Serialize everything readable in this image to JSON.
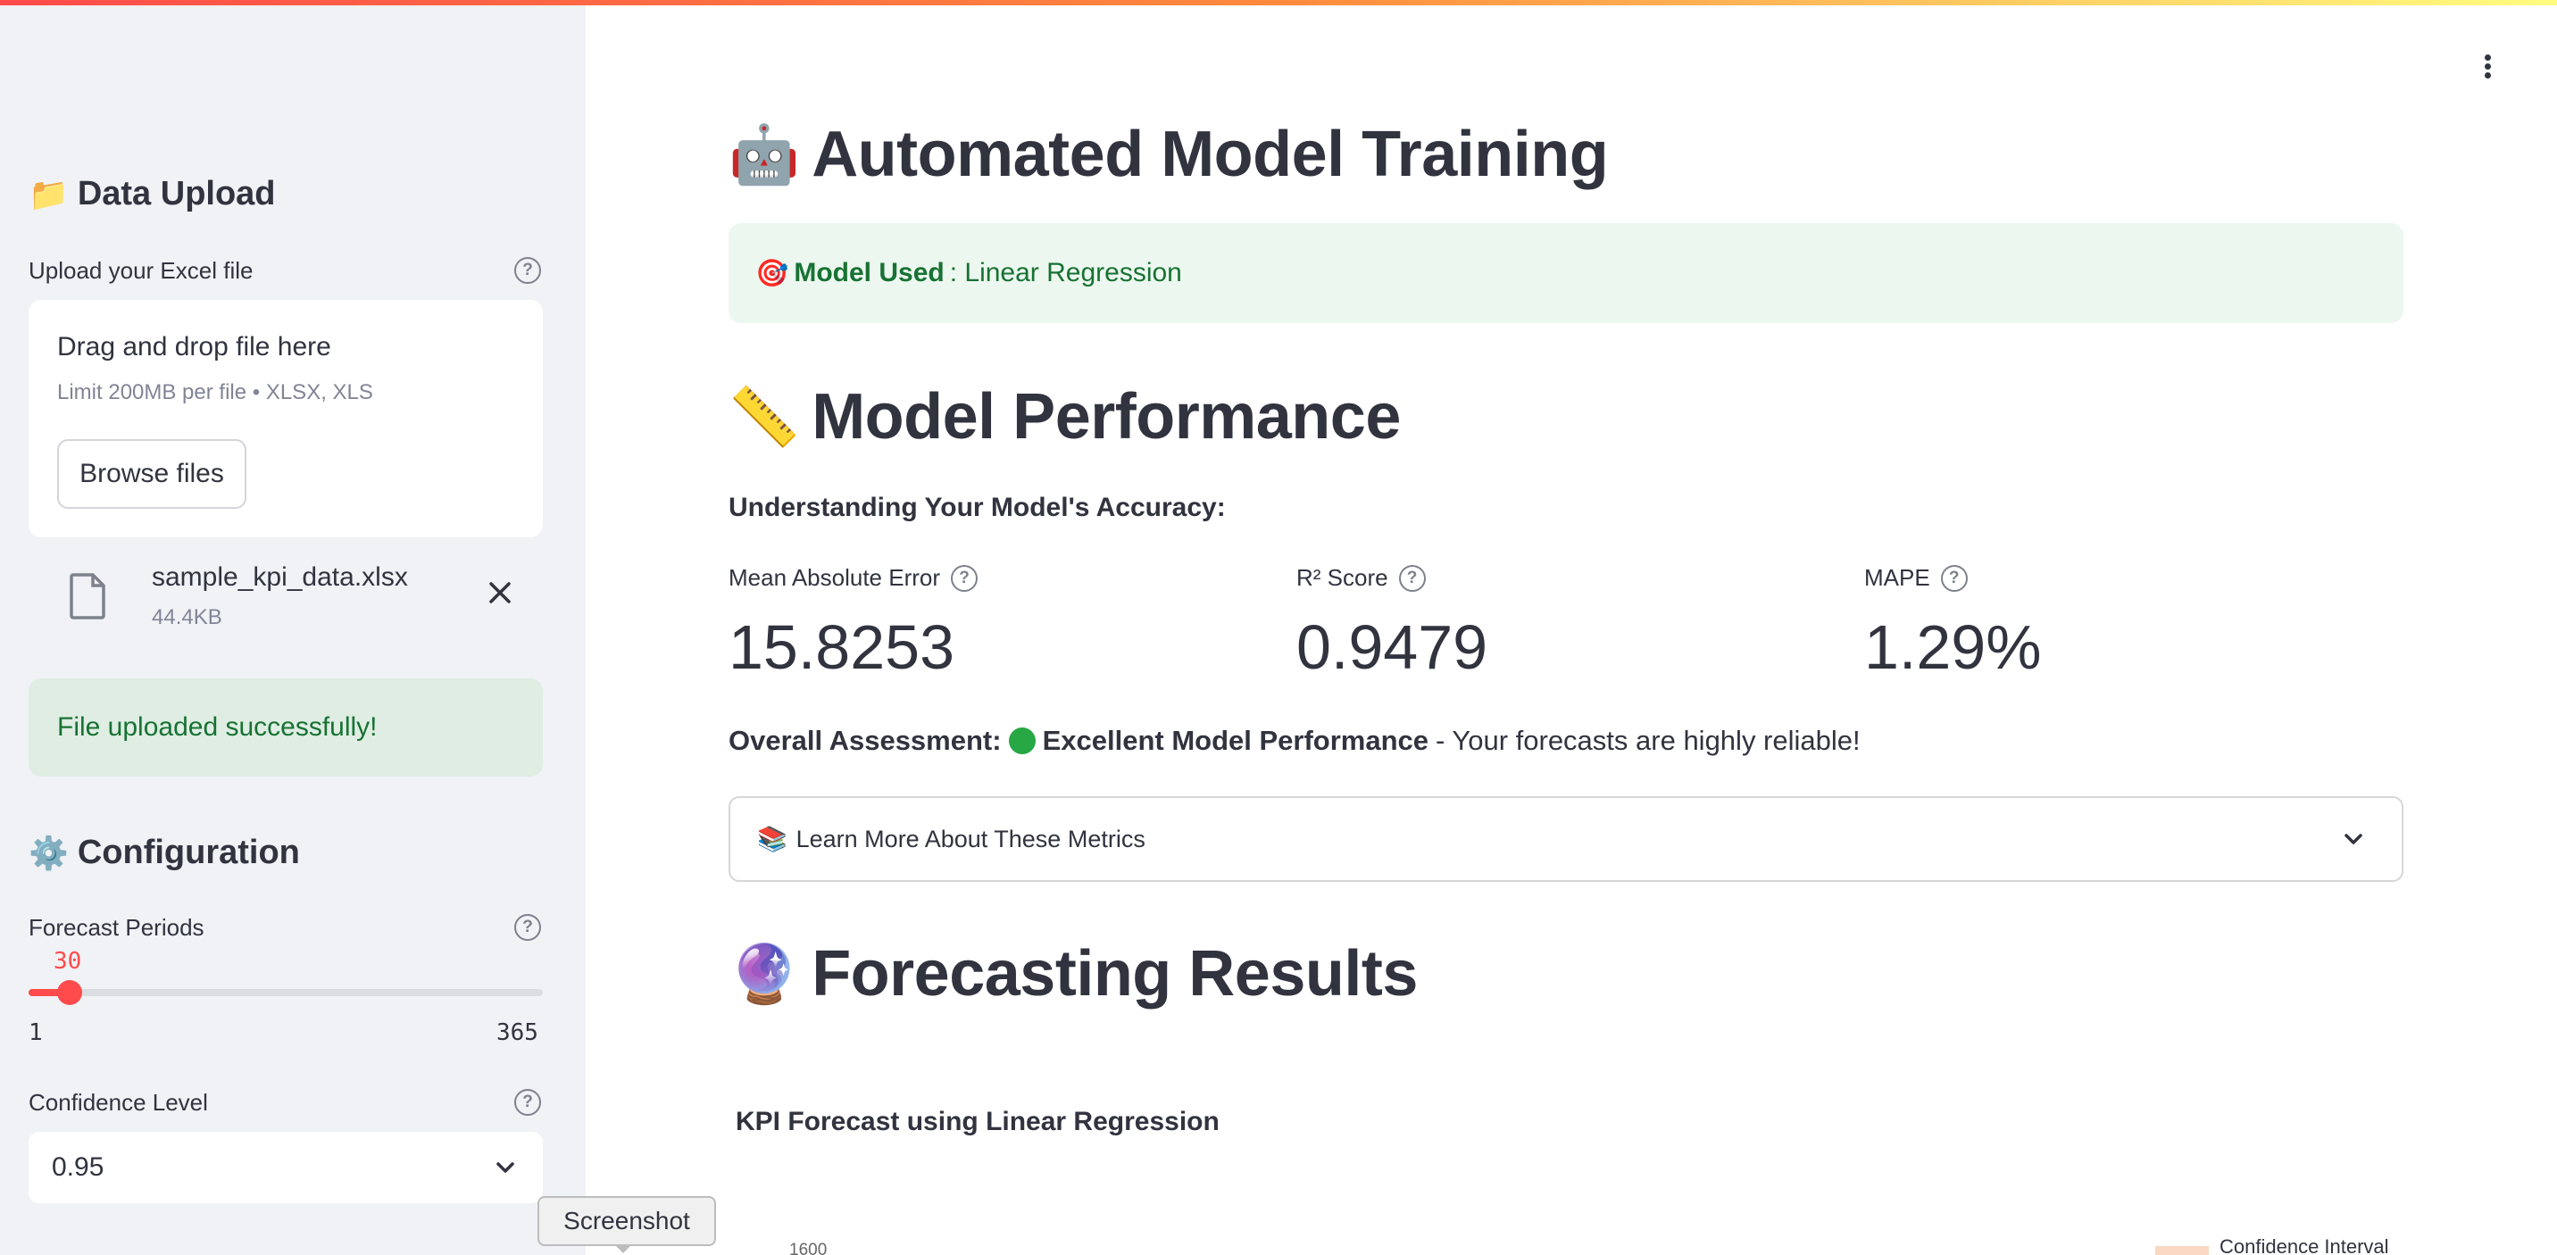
{
  "sidebar": {
    "upload_heading": "Data Upload",
    "upload_heading_icon": "folder-icon",
    "upload_label": "Upload your Excel file",
    "dropzone_title": "Drag and drop file here",
    "dropzone_limit": "Limit 200MB per file • XLSX, XLS",
    "browse_button": "Browse files",
    "file_name": "sample_kpi_data.xlsx",
    "file_size": "44.4KB",
    "success_message": "File uploaded successfully!",
    "config_heading": "Configuration",
    "config_heading_icon": "gear-icon",
    "forecast_label": "Forecast Periods",
    "forecast_value": "30",
    "forecast_min": "1",
    "forecast_max": "365",
    "forecast_fraction": 0.0797,
    "confidence_label": "Confidence Level",
    "confidence_value": "0.95"
  },
  "tooltip": "Screenshot",
  "main": {
    "title": "Automated Model Training",
    "title_icon": "robot-icon",
    "model_label": "Model Used",
    "model_value": ": Linear Regression",
    "model_icon": "target-icon",
    "performance_title": "Model Performance",
    "performance_icon": "ruler-icon",
    "understanding": "Understanding Your Model's Accuracy:",
    "metrics": [
      {
        "label": "Mean Absolute Error",
        "value": "15.8253"
      },
      {
        "label": "R² Score",
        "value": "0.9479"
      },
      {
        "label": "MAPE",
        "value": "1.29%"
      }
    ],
    "assessment_label": "Overall Assessment:",
    "assessment_rating": "Excellent Model Performance",
    "assessment_text": "- Your forecasts are highly reliable!",
    "expander_label": "Learn More About These Metrics",
    "expander_icon": "books-icon",
    "forecast_title": "Forecasting Results",
    "forecast_icon": "crystal-ball-icon",
    "chart_title": "KPI Forecast using Linear Regression",
    "chart_first_tick": "1600",
    "legend_label": "Confidence Interval"
  },
  "colors": {
    "accent": "#ff4b4b",
    "success_bg": "#dfede3",
    "success_text": "#177233",
    "sidebar_bg": "#f0f2f6"
  }
}
